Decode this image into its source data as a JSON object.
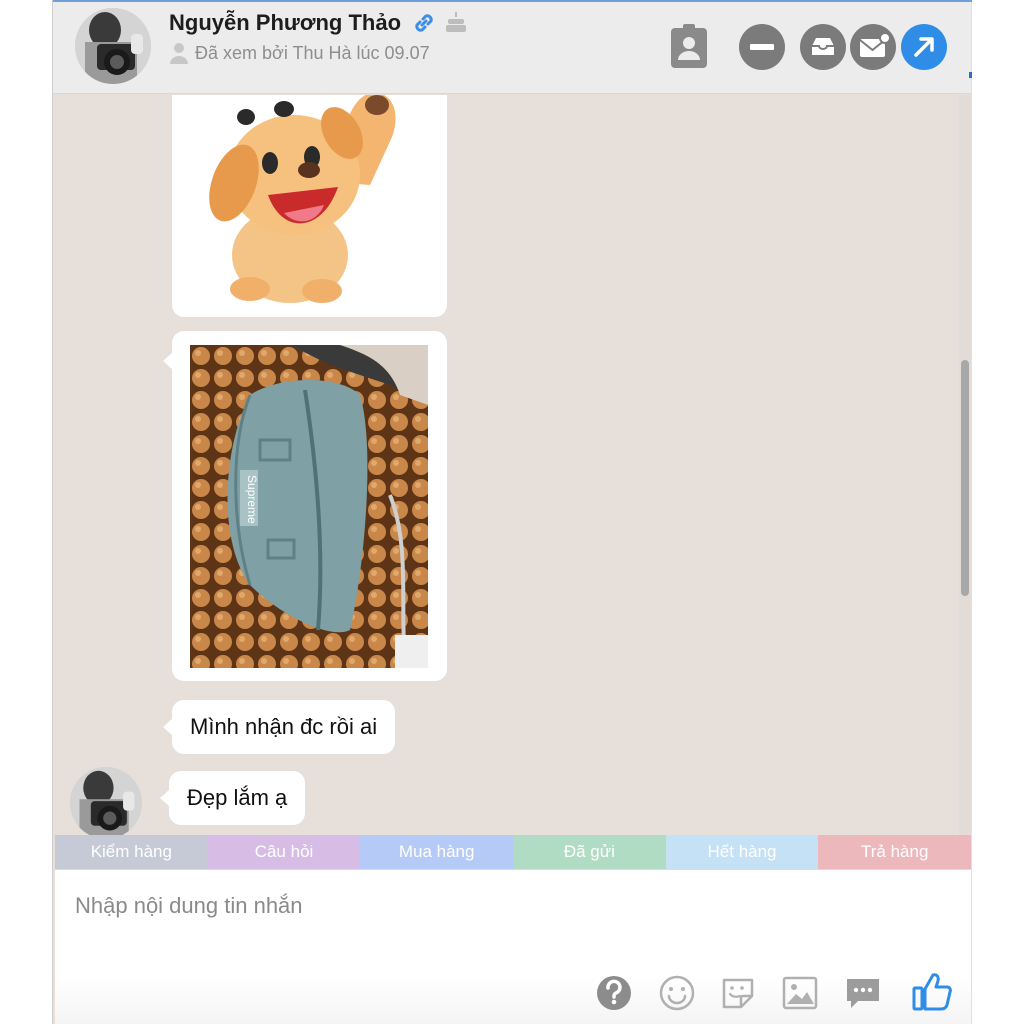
{
  "header": {
    "contact_name": "Nguyễn Phương Thảo",
    "seen_status": "Đã xem bởi Thu Hà lúc 09.07",
    "icons": [
      "avatar",
      "link-icon",
      "cake-icon",
      "person-icon",
      "contact-card-icon",
      "minimize-icon",
      "archive-icon",
      "email-icon",
      "expand-icon"
    ]
  },
  "messages": [
    {
      "type": "sticker",
      "content": "waving dog sticker"
    },
    {
      "type": "image",
      "content": "photo of teal waist bag"
    },
    {
      "type": "text",
      "text": "Mình nhận đc rồi ai"
    },
    {
      "type": "text",
      "text": "Đẹp lắm ạ"
    }
  ],
  "photo": {
    "brand_text": "Supreme"
  },
  "tags": [
    {
      "label": "Kiểm hàng",
      "color": "#c6c9d6"
    },
    {
      "label": "Câu hỏi",
      "color": "#d7bde6"
    },
    {
      "label": "Mua hàng",
      "color": "#b5caf6"
    },
    {
      "label": "Đã gửi",
      "color": "#b1dcc4"
    },
    {
      "label": "Hết hàng",
      "color": "#c5e1f5"
    },
    {
      "label": "Trả hàng",
      "color": "#ecb8bc"
    }
  ],
  "composer": {
    "placeholder": "Nhập nội dung tin nhắn",
    "tools": [
      "help-icon",
      "emoji-icon",
      "sticker-icon",
      "image-icon",
      "quick-reply-icon",
      "like-icon"
    ]
  },
  "colors": {
    "accent": "#2f8de8",
    "chat_background": "#e6dfda",
    "header_background": "#ececec"
  }
}
